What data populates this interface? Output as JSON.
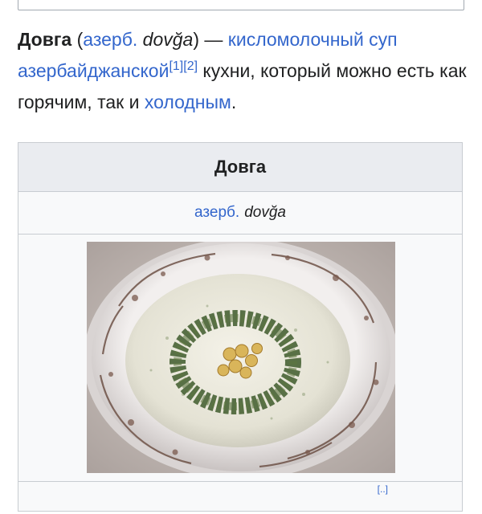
{
  "lead": {
    "term": "Довга",
    "open_paren": " (",
    "lang_link": "азерб.",
    "native_name": "dovğa",
    "close_dash": ") — ",
    "link_soup": "кисломолочный суп",
    "link_cuisine": "азербайджанской",
    "ref1": "[1]",
    "ref2": "[2]",
    "text_after_refs": " кухни, который можно есть как горячим, так и ",
    "link_cold": "холодным",
    "end_period": "."
  },
  "infobox": {
    "title": "Довга",
    "lang_link": "азерб.",
    "native_name": "dovğa",
    "caption_ref_partial": "[..]"
  },
  "colors": {
    "link": "#3366cc",
    "text": "#202122",
    "infobox_header_bg": "#eaecf0",
    "infobox_bg": "#f8f9fa",
    "border": "#c8ccd1"
  }
}
